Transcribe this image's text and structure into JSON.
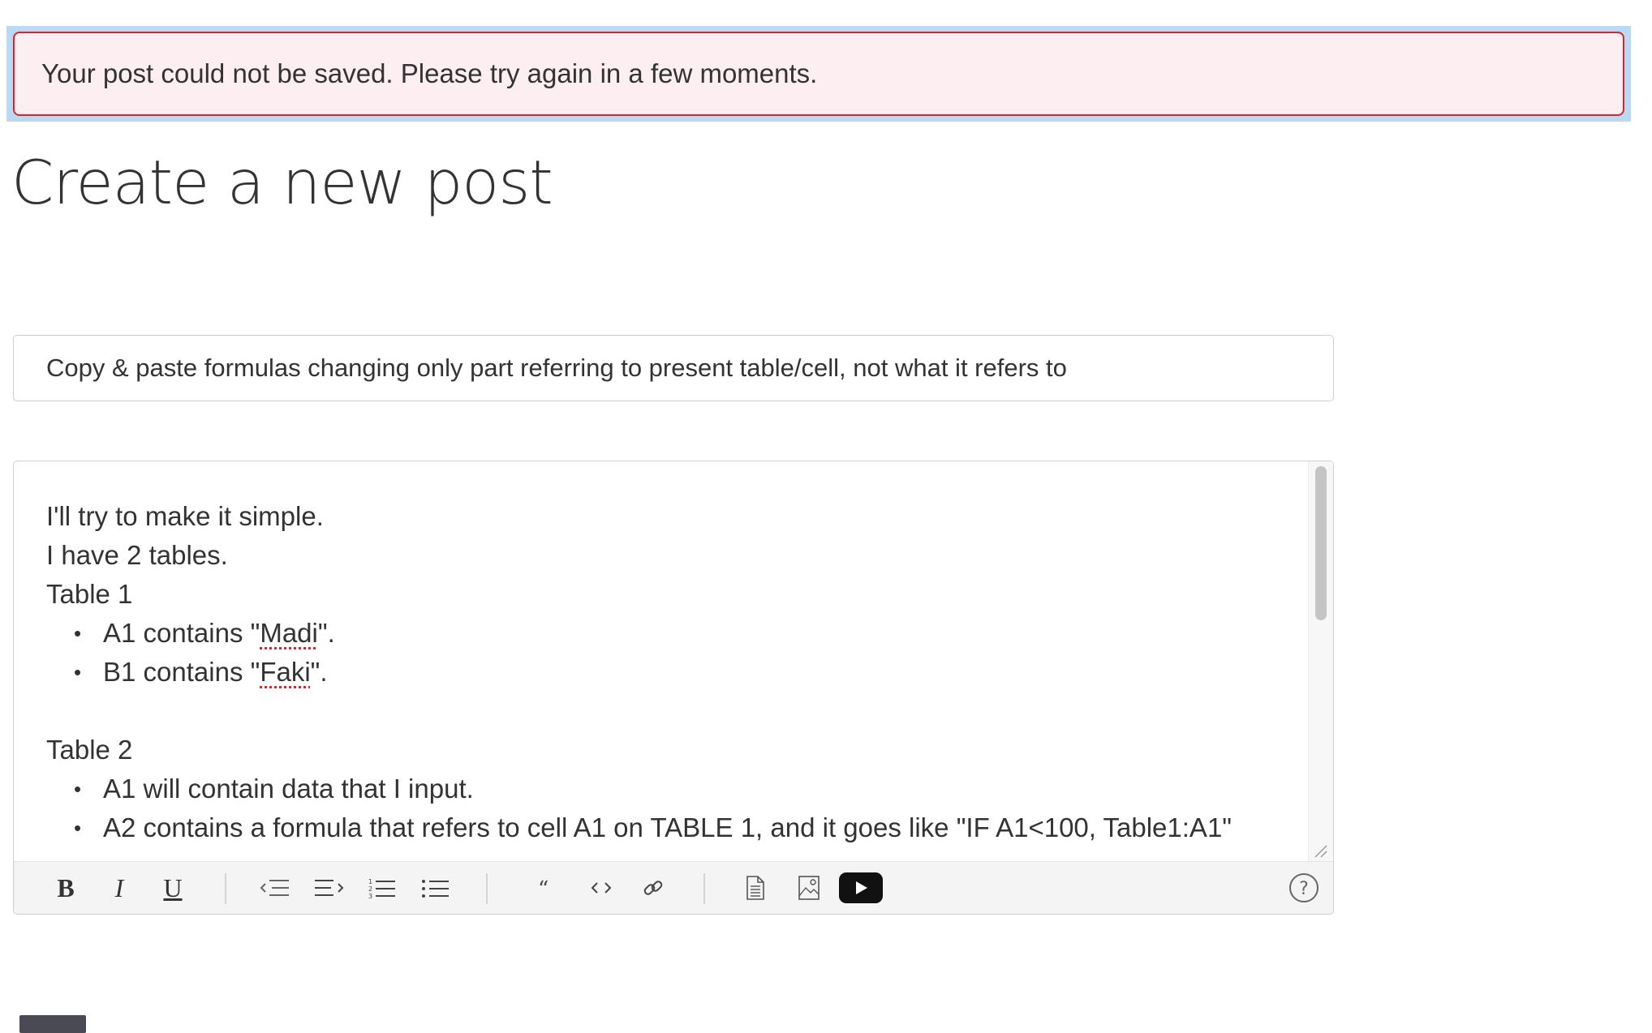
{
  "alert": {
    "message": "Your post could not be saved. Please try again in a few moments.",
    "colors": {
      "background": "#fdeef1",
      "border": "#d9242b",
      "outline": "#bcd9f4"
    }
  },
  "page": {
    "title": "Create a new post"
  },
  "post_title": {
    "value": "Copy & paste formulas changing only part referring to present table/cell, not what it refers to"
  },
  "editor": {
    "line1": "I'll try to make it simple.",
    "line2": "I have 2 tables.",
    "table1_heading": "Table 1",
    "table1_item1_prefix": "A1 contains \"",
    "table1_item1_word": "Madi",
    "table1_item1_suffix": "\".",
    "table1_item2_prefix": "B1 contains \"",
    "table1_item2_word": "Faki",
    "table1_item2_suffix": "\".",
    "table2_heading": "Table 2",
    "table2_item1": "A1 will contain data that I input.",
    "table2_item2": "A2 contains a formula that refers to cell A1 on TABLE 1, and it goes like \"IF A1<100, Table1:A1\""
  },
  "toolbar": {
    "bold": "B",
    "italic": "I",
    "underline": "U",
    "icons": [
      "bold-icon",
      "italic-icon",
      "underline-icon",
      "outdent-icon",
      "indent-icon",
      "numbered-list-icon",
      "bulleted-list-icon",
      "quote-icon",
      "code-icon",
      "link-icon",
      "attach-file-icon",
      "insert-image-icon",
      "insert-video-icon",
      "help-icon"
    ]
  }
}
